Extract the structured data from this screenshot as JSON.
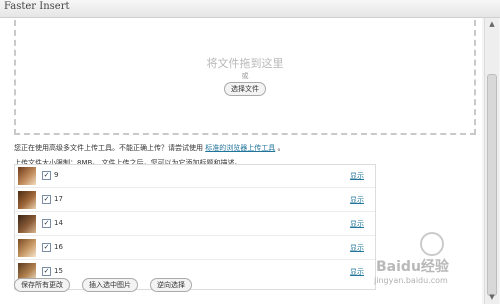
{
  "window": {
    "title": "Faster Insert"
  },
  "dropzone": {
    "title": "将文件拖到这里",
    "or_text": "或",
    "select_button": "选择文件"
  },
  "notes": {
    "uploader_text": "您正在使用高级多文件上传工具。不能正确上传？请尝试使用",
    "uploader_link": "标准的浏览器上传工具",
    "uploader_end": "。",
    "size_limit": "上传文件大小限制：8MB。 文件上传之后，您可以为它添加标题和描述。"
  },
  "files": [
    {
      "name": "9",
      "checked": true,
      "action": "显示"
    },
    {
      "name": "17",
      "checked": true,
      "action": "显示"
    },
    {
      "name": "14",
      "checked": true,
      "action": "显示"
    },
    {
      "name": "16",
      "checked": true,
      "action": "显示"
    },
    {
      "name": "15",
      "checked": true,
      "action": "显示"
    }
  ],
  "buttons": {
    "save_all": "保存所有更改",
    "insert_selected": "插入选中图片",
    "invert_selection": "逆向选择"
  },
  "watermark": {
    "text": "Baidu经验",
    "url": "jingyan.baidu.com"
  },
  "colors": {
    "link": "#21759b",
    "dashed_border": "#c9c9c9"
  }
}
